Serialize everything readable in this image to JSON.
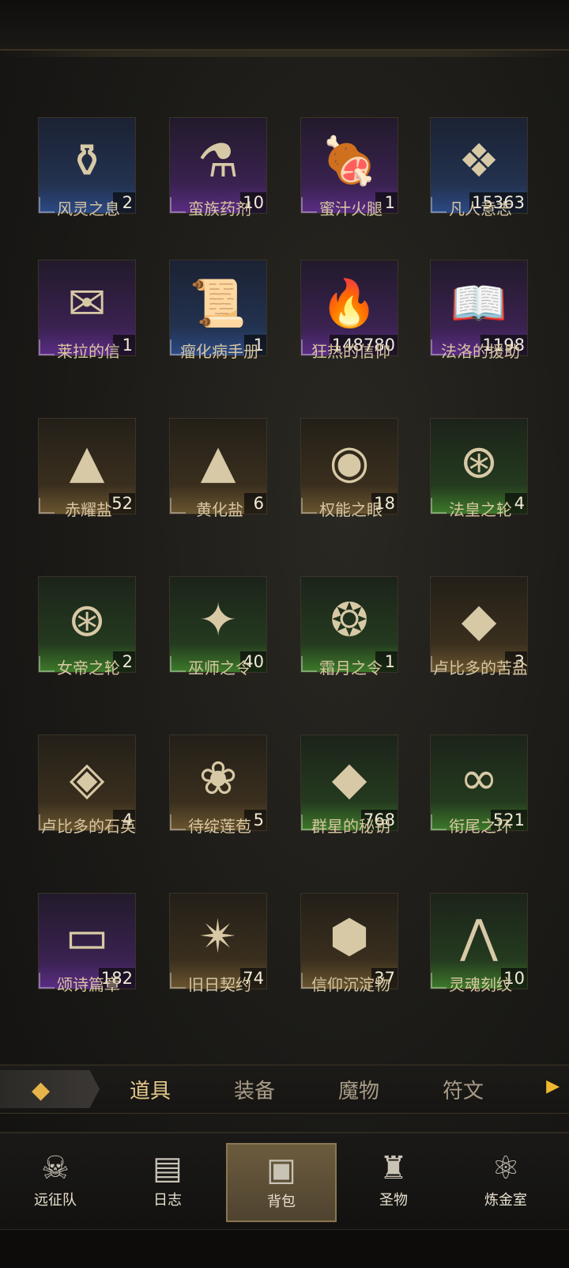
{
  "items": [
    {
      "name": "风灵之息",
      "count": "2",
      "rarity": "blue",
      "icon": "bottle-eye-icon",
      "glyph": "⚱"
    },
    {
      "name": "蛮族药剂",
      "count": "10",
      "rarity": "purple",
      "icon": "potion-icon",
      "glyph": "⚗"
    },
    {
      "name": "蜜汁火腿",
      "count": "1",
      "rarity": "purple",
      "icon": "ham-icon",
      "glyph": "🍖"
    },
    {
      "name": "凡人意志",
      "count": "15363",
      "rarity": "blue",
      "icon": "crystal-icon",
      "glyph": "❖"
    },
    {
      "name": "莱拉的信",
      "count": "1",
      "rarity": "purple",
      "icon": "letter-icon",
      "glyph": "✉"
    },
    {
      "name": "瘤化病手册",
      "count": "1",
      "rarity": "blue",
      "icon": "scroll-icon",
      "glyph": "📜"
    },
    {
      "name": "狂热的信仰",
      "count": "148780",
      "rarity": "purple",
      "icon": "flame-icon",
      "glyph": "🔥"
    },
    {
      "name": "法洛的援助",
      "count": "1198",
      "rarity": "purple",
      "icon": "book-icon",
      "glyph": "📖"
    },
    {
      "name": "赤耀盐",
      "count": "52",
      "rarity": "gold",
      "icon": "red-salt-icon",
      "glyph": "▲"
    },
    {
      "name": "黄化盐",
      "count": "6",
      "rarity": "gold",
      "icon": "yellow-salt-icon",
      "glyph": "▲"
    },
    {
      "name": "权能之眼",
      "count": "18",
      "rarity": "gold",
      "icon": "eye-icon",
      "glyph": "◉"
    },
    {
      "name": "法皇之轮",
      "count": "4",
      "rarity": "green",
      "icon": "wheel-icon",
      "glyph": "⊛"
    },
    {
      "name": "女帝之轮",
      "count": "2",
      "rarity": "green",
      "icon": "red-wheel-icon",
      "glyph": "⊛"
    },
    {
      "name": "巫师之令",
      "count": "40",
      "rarity": "green",
      "icon": "token-icon",
      "glyph": "✦"
    },
    {
      "name": "霜月之令",
      "count": "1",
      "rarity": "green",
      "icon": "silver-token-icon",
      "glyph": "❂"
    },
    {
      "name": "卢比多的苦盐",
      "count": "3",
      "rarity": "gold",
      "icon": "salt-bag-icon",
      "glyph": "◆"
    },
    {
      "name": "卢比多的石英",
      "count": "4",
      "rarity": "gold",
      "icon": "quartz-icon",
      "glyph": "◈"
    },
    {
      "name": "待绽莲苞",
      "count": "5",
      "rarity": "gold",
      "icon": "lotus-icon",
      "glyph": "❀"
    },
    {
      "name": "群星的秘钥",
      "count": "768",
      "rarity": "green",
      "icon": "star-key-icon",
      "glyph": "◆"
    },
    {
      "name": "衔尾之环",
      "count": "521",
      "rarity": "green",
      "icon": "ouroboros-icon",
      "glyph": "∞"
    },
    {
      "name": "颂诗篇章",
      "count": "182",
      "rarity": "purple",
      "icon": "page-icon",
      "glyph": "▭"
    },
    {
      "name": "旧日契约",
      "count": "74",
      "rarity": "gold",
      "icon": "pact-icon",
      "glyph": "✴"
    },
    {
      "name": "信仰沉淀物",
      "count": "37",
      "rarity": "gold",
      "icon": "ore-icon",
      "glyph": "⬢"
    },
    {
      "name": "灵魂刻纹",
      "count": "10",
      "rarity": "green",
      "icon": "rune-icon",
      "glyph": "⋀"
    }
  ],
  "tabs": {
    "items": [
      "道具",
      "装备",
      "魔物",
      "符文"
    ],
    "active": "道具"
  },
  "nav": {
    "items": [
      {
        "label": "远征队",
        "icon": "viking-helmet-icon",
        "glyph": "☠"
      },
      {
        "label": "日志",
        "icon": "journal-icon",
        "glyph": "📜"
      },
      {
        "label": "背包",
        "icon": "backpack-icon",
        "glyph": "🎒"
      },
      {
        "label": "圣物",
        "icon": "chalice-icon",
        "glyph": "♜"
      },
      {
        "label": "炼金室",
        "icon": "alchemy-icon",
        "glyph": "⚛"
      }
    ],
    "active": "背包"
  },
  "colors": {
    "accent": "#e7b44a",
    "tab_active": "#e6c98c",
    "tab_inactive": "#a79c86"
  }
}
